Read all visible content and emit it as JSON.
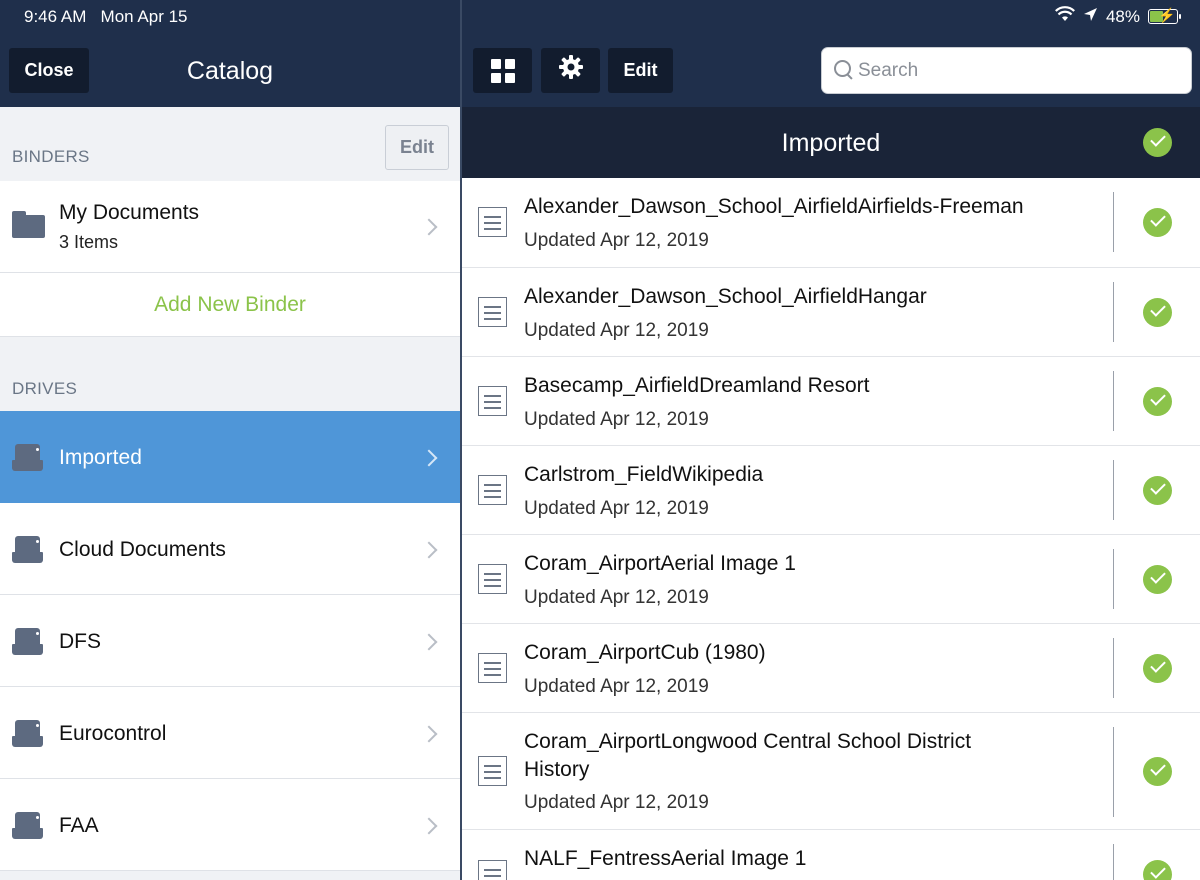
{
  "status_bar": {
    "time": "9:46 AM",
    "date": "Mon Apr 15",
    "battery": "48%",
    "battery_level": 0.48,
    "icons": [
      "wifi-icon",
      "location-arrow-icon",
      "battery-charging-icon"
    ]
  },
  "left_header": {
    "close_label": "Close",
    "title": "Catalog"
  },
  "toolbar": {
    "icons": [
      "grid-icon",
      "gear-icon"
    ],
    "edit_label": "Edit",
    "search_placeholder": "Search"
  },
  "binders": {
    "heading": "BINDERS",
    "edit_label": "Edit",
    "items": [
      {
        "title": "My Documents",
        "subtitle": "3 Items",
        "icon": "folder-icon"
      }
    ],
    "add_label": "Add New Binder"
  },
  "drives": {
    "heading": "DRIVES",
    "items": [
      {
        "title": "Imported",
        "selected": true,
        "icon": "drive-icon"
      },
      {
        "title": "Cloud Documents",
        "selected": false,
        "icon": "drive-icon"
      },
      {
        "title": "DFS",
        "selected": false,
        "icon": "drive-icon"
      },
      {
        "title": "Eurocontrol",
        "selected": false,
        "icon": "drive-icon"
      },
      {
        "title": "FAA",
        "selected": false,
        "icon": "drive-icon"
      }
    ]
  },
  "list": {
    "title": "Imported",
    "documents": [
      {
        "title": "Alexander_Dawson_School_AirfieldAirfields-Freeman",
        "updated": "Updated Apr 12, 2019"
      },
      {
        "title": "Alexander_Dawson_School_AirfieldHangar",
        "updated": "Updated Apr 12, 2019"
      },
      {
        "title": "Basecamp_AirfieldDreamland Resort",
        "updated": "Updated Apr 12, 2019"
      },
      {
        "title": "Carlstrom_FieldWikipedia",
        "updated": "Updated Apr 12, 2019"
      },
      {
        "title": "Coram_AirportAerial Image 1",
        "updated": "Updated Apr 12, 2019"
      },
      {
        "title": "Coram_AirportCub (1980)",
        "updated": "Updated Apr 12, 2019"
      },
      {
        "title": "Coram_AirportLongwood Central School District History",
        "updated": "Updated Apr 12, 2019"
      },
      {
        "title": "NALF_FentressAerial Image 1",
        "updated": ""
      }
    ]
  },
  "colors": {
    "nav_background": "#1f2f4b",
    "selected_row": "#4f96d8",
    "accent_green": "#8bc34a"
  }
}
